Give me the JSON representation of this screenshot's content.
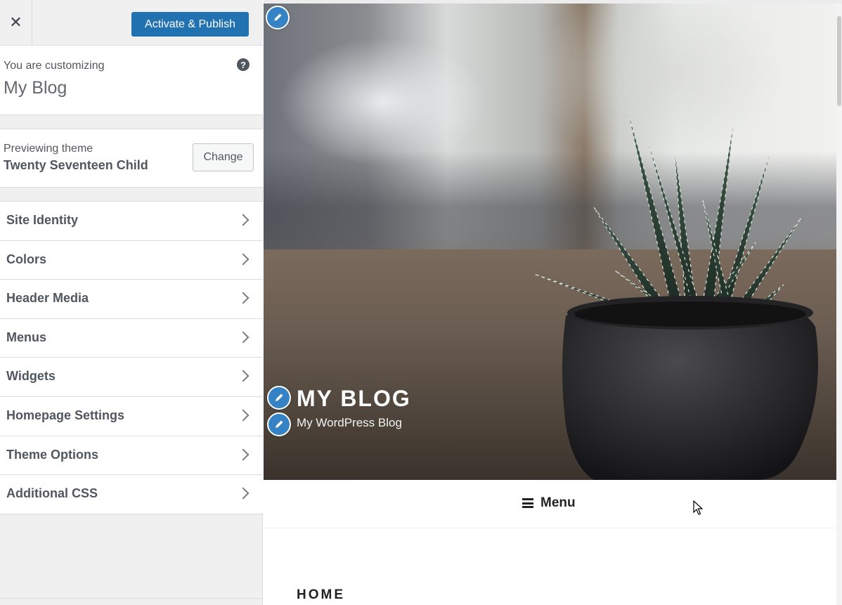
{
  "topbar": {
    "close_glyph": "✕",
    "publish_label": "Activate & Publish"
  },
  "info": {
    "preline": "You are customizing",
    "site_name": "My Blog",
    "help_glyph": "?"
  },
  "theme": {
    "preline": "Previewing theme",
    "name": "Twenty Seventeen Child",
    "change_label": "Change"
  },
  "sections": [
    {
      "label": "Site Identity"
    },
    {
      "label": "Colors"
    },
    {
      "label": "Header Media"
    },
    {
      "label": "Menus"
    },
    {
      "label": "Widgets"
    },
    {
      "label": "Homepage Settings"
    },
    {
      "label": "Theme Options"
    },
    {
      "label": "Additional CSS"
    }
  ],
  "preview": {
    "site_title": "MY BLOG",
    "site_description": "My WordPress Blog",
    "menu_label": "Menu",
    "home_heading": "HOME"
  },
  "colors": {
    "primary_button": "#2271b1",
    "edit_shortcut": "#3582c4"
  },
  "icons": {
    "close": "close-icon",
    "help": "help-icon",
    "chevron": "chevron-right-icon",
    "edit": "pencil-icon",
    "menu": "hamburger-icon",
    "cursor": "mouse-cursor-icon"
  }
}
